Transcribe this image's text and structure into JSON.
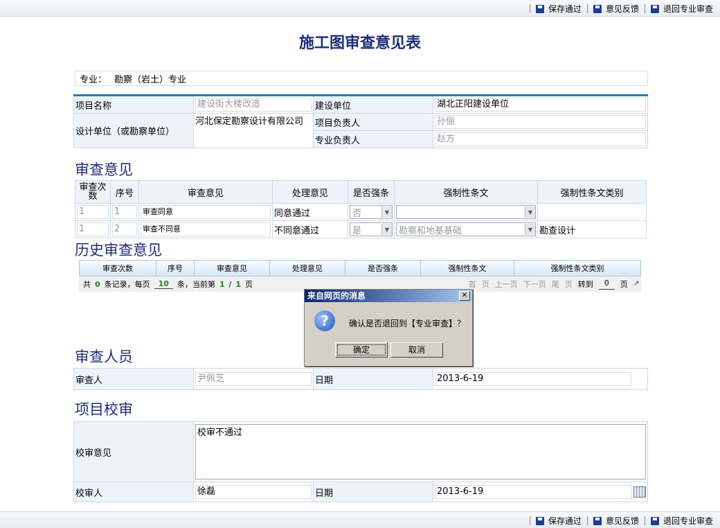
{
  "toolbar": {
    "save": "保存通过",
    "feedback": "意见反馈",
    "return": "退回专业审查"
  },
  "title": "施工图审查意见表",
  "major": {
    "label": "专业：",
    "value": "勘察（岩土）专业"
  },
  "info": {
    "project_name_label": "项目名称",
    "project_name": "建设街大楼改造",
    "builder_label": "建设单位",
    "builder": "湖北正阳建设单位",
    "design_unit_label": "设计单位（或勘察单位）",
    "design_unit": "河北保定勘察设计有限公司",
    "pm_label": "项目负责人",
    "pm": "孙俪",
    "lead_label": "专业负责人",
    "lead": "赵方"
  },
  "review_section": "审查意见",
  "review_table": {
    "headers": [
      "审查次数",
      "序号",
      "审查意见",
      "处理意见",
      "是否强条",
      "强制性条文",
      "强制性条文类别"
    ],
    "rows": [
      {
        "count": "1",
        "seq": "1",
        "opinion": "审查同意",
        "handle": "同意通过",
        "mandatory": "否",
        "clause": "",
        "category": ""
      },
      {
        "count": "1",
        "seq": "2",
        "opinion": "审查不同意",
        "handle": "不同意通过",
        "mandatory": "是",
        "clause": "勘察和地基基础",
        "category": "勘查设计"
      }
    ]
  },
  "history_section": "历史审查意见",
  "history": {
    "headers": [
      "审查次数",
      "序号",
      "审查意见",
      "处理意见",
      "是否强条",
      "强制性条文",
      "强制性条文类别"
    ],
    "pager": {
      "total_prefix": "共",
      "total": "0",
      "per_page_text": "条记录，每页",
      "per_page": "10",
      "current_text": "条，当前第",
      "current": "1",
      "slash": "/",
      "pages": "1",
      "page_word": "页",
      "first": "首",
      "first2": "页",
      "prev": "上一页",
      "next": "下一页",
      "last": "尾",
      "last2": "页",
      "goto": "转到",
      "goto_val": "0",
      "goto_page": "页"
    }
  },
  "dialog": {
    "title": "来自网页的消息",
    "message": "确认是否退回到【专业审查】？",
    "ok": "确定",
    "cancel": "取消"
  },
  "auditor_section": "审查人员",
  "auditor": {
    "label": "审查人",
    "name": "尹佩芝",
    "date_label": "日期",
    "date": "2013-6-19"
  },
  "proj_section": "项目校审",
  "proj": {
    "opinion_label": "校审意见",
    "opinion": "校审不通过",
    "checker_label": "校审人",
    "checker": "徐磊",
    "date_label": "日期",
    "date": "2013-6-19"
  }
}
